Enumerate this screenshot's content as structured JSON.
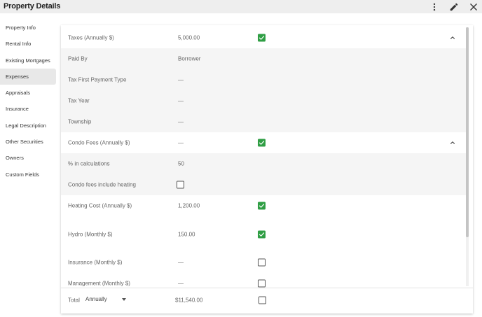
{
  "header": {
    "title": "Property Details",
    "icons": [
      "more-vert-icon",
      "pencil-icon",
      "close-icon"
    ]
  },
  "sidebar": {
    "items": [
      {
        "label": "Property Info",
        "active": false
      },
      {
        "label": "Rental Info",
        "active": false
      },
      {
        "label": "Existing Mortgages",
        "active": false
      },
      {
        "label": "Expenses",
        "active": true
      },
      {
        "label": "Appraisals",
        "active": false
      },
      {
        "label": "Insurance",
        "active": false
      },
      {
        "label": "Legal Description",
        "active": false
      },
      {
        "label": "Other Securities",
        "active": false
      },
      {
        "label": "Owners",
        "active": false
      },
      {
        "label": "Custom Fields",
        "active": false
      }
    ]
  },
  "expenses": {
    "rows": [
      {
        "label": "Taxes (Annually $)",
        "value": "5,000.00",
        "checked": true,
        "expandable": true,
        "sub": false
      },
      {
        "label": "Paid By",
        "value": "Borrower",
        "sub": true
      },
      {
        "label": "Tax First Payment Type",
        "value": "—",
        "sub": true
      },
      {
        "label": "Tax Year",
        "value": "—",
        "sub": true
      },
      {
        "label": "Township",
        "value": "—",
        "sub": true
      },
      {
        "label": "Condo Fees (Annually $)",
        "value": "—",
        "checked": true,
        "expandable": true,
        "sub": false
      },
      {
        "label": "% in calculations",
        "value": "50",
        "sub": true
      },
      {
        "label": "Condo fees include heating",
        "value": "",
        "inline_checkbox": false,
        "sub": true
      },
      {
        "label": "Heating Cost (Annually $)",
        "value": "1,200.00",
        "checked": true,
        "sub": false
      },
      {
        "label": "Hydro (Monthly $)",
        "value": "150.00",
        "checked": true,
        "sub": false
      },
      {
        "label": "Insurance (Monthly $)",
        "value": "—",
        "checked": false,
        "sub": false
      },
      {
        "label": "Management (Monthly $)",
        "value": "—",
        "checked": false,
        "sub": false
      }
    ],
    "total": {
      "label": "Total",
      "period": "Annually",
      "value": "$11,540.00",
      "checked": false
    }
  }
}
